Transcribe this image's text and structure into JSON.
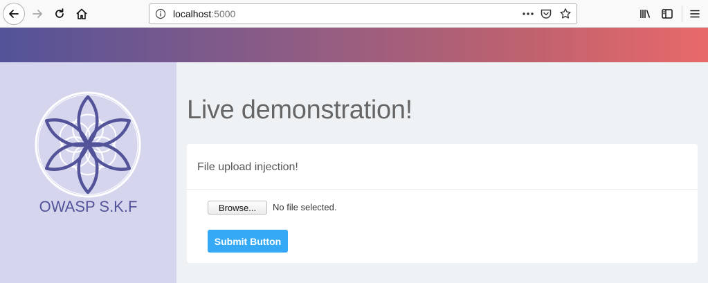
{
  "browser": {
    "url_host": "localhost",
    "url_port": ":5000"
  },
  "sidebar": {
    "brand": "OWASP S.K.F"
  },
  "main": {
    "title": "Live demonstration!",
    "card_title": "File upload injection!",
    "browse_label": "Browse...",
    "file_status": "No file selected.",
    "submit_label": "Submit Button"
  },
  "colors": {
    "brand": "#535399",
    "accent": "#35a9f5",
    "sidebar_bg": "#d5d6ee",
    "gradient_start": "#535399",
    "gradient_end": "#e8696a"
  }
}
